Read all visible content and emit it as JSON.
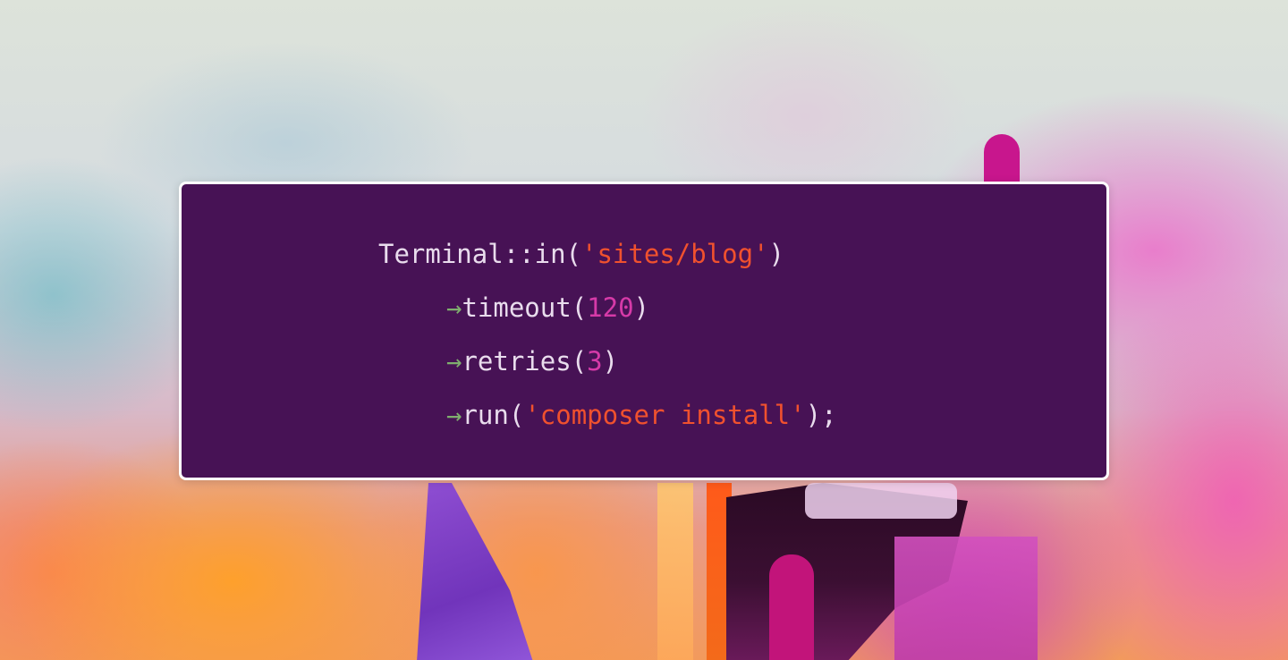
{
  "code": {
    "line1": {
      "class": "Terminal",
      "op": "::",
      "method": "in",
      "open": "(",
      "string": "'sites/blog'",
      "close": ")"
    },
    "line2": {
      "arrow": "→",
      "method": "timeout",
      "open": "(",
      "number": "120",
      "close": ")"
    },
    "line3": {
      "arrow": "→",
      "method": "retries",
      "open": "(",
      "number": "3",
      "close": ")"
    },
    "line4": {
      "arrow": "→",
      "method": "run",
      "open": "(",
      "string": "'composer install'",
      "close": ");"
    }
  },
  "colors": {
    "card_background": "#471255",
    "card_border": "#ffffff",
    "text": "#e9dced",
    "string": "#f0512e",
    "number": "#d63aa8",
    "arrow": "#7fae6e"
  }
}
